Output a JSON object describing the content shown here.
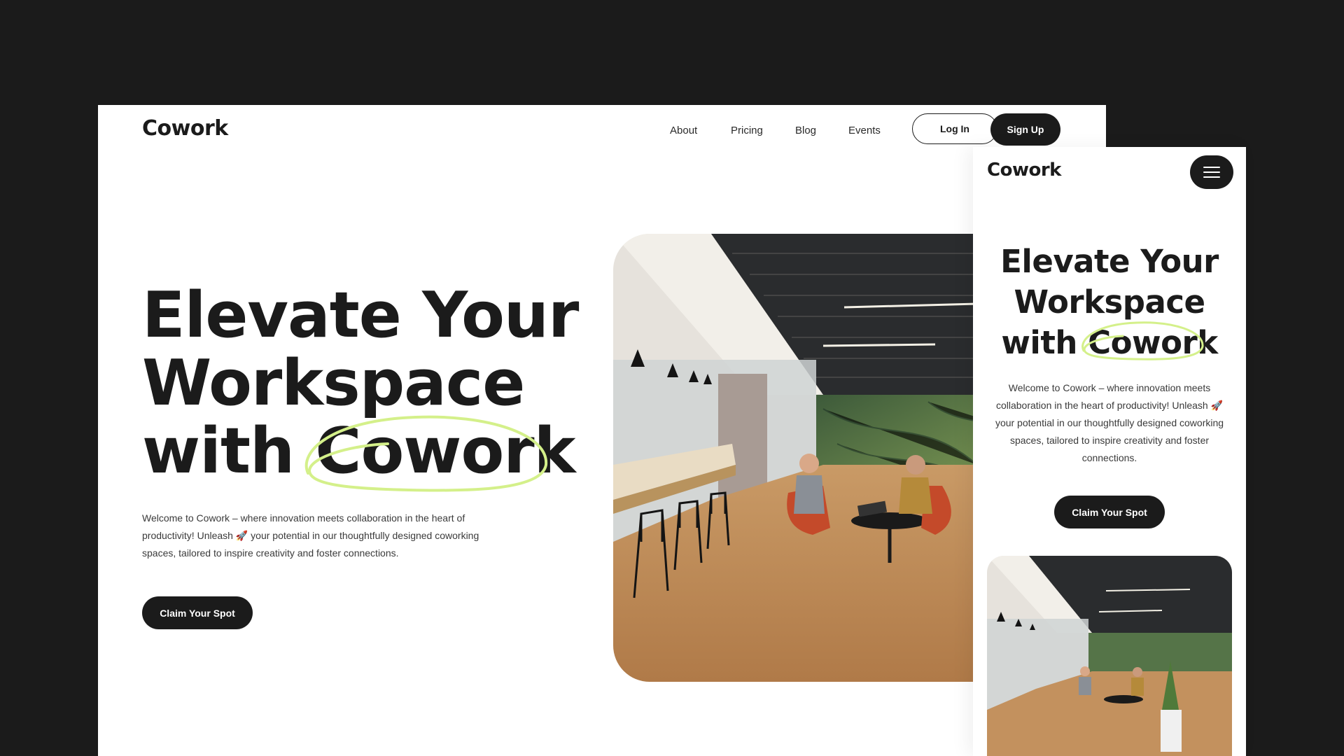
{
  "brand": {
    "name": "Cowork",
    "accent": "#d4f08a",
    "dark": "#1b1b1b"
  },
  "nav": {
    "about": "About",
    "pricing": "Pricing",
    "blog": "Blog",
    "events": "Events",
    "login": "Log In",
    "signup": "Sign Up"
  },
  "hero": {
    "title_line1": "Elevate Your",
    "title_line2": "Workspace",
    "title_with": "with ",
    "title_highlight": "Cowork",
    "description": "Welcome to Cowork – where innovation meets collaboration in the heart  of productivity! Unleash 🚀 your potential in our thoughtfully designed coworking spaces, tailored to inspire creativity and foster connections.",
    "cta": "Claim Your Spot"
  },
  "mobile": {
    "menu_icon": "hamburger-menu-icon"
  }
}
